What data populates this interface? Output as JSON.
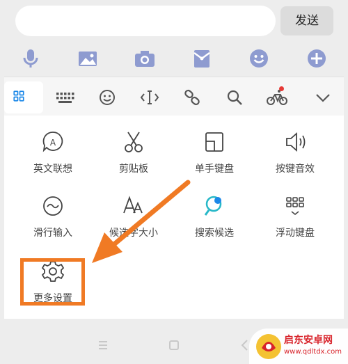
{
  "input": {
    "placeholder": "",
    "value": ""
  },
  "send_label": "发送",
  "toolbar_icons": [
    "microphone-icon",
    "image-icon",
    "camera-icon",
    "red-envelope-icon",
    "emoji-icon",
    "plus-icon"
  ],
  "keyboard_tabs": [
    "grid-icon",
    "keyboard-icon",
    "emoji-icon",
    "cursor-icon",
    "link-icon",
    "search-icon",
    "bike-icon",
    "collapse-icon"
  ],
  "panel": {
    "items": [
      {
        "label": "英文联想",
        "icon": "english-associate-icon"
      },
      {
        "label": "剪贴板",
        "icon": "scissors-icon"
      },
      {
        "label": "单手键盘",
        "icon": "one-hand-keyboard-icon"
      },
      {
        "label": "按键音效",
        "icon": "speaker-icon"
      },
      {
        "label": "滑行输入",
        "icon": "swipe-input-icon"
      },
      {
        "label": "候选字大小",
        "icon": "font-size-icon"
      },
      {
        "label": "搜索候选",
        "icon": "search-candidate-icon"
      },
      {
        "label": "浮动键盘",
        "icon": "floating-keyboard-icon"
      },
      {
        "label": "更多设置",
        "icon": "gear-icon"
      }
    ]
  },
  "watermark": {
    "title": "启东安卓网",
    "url": "www.qdltdx.com"
  },
  "colors": {
    "accent": "#1b88e8",
    "highlight": "#f07a24",
    "badge": "#e63a36",
    "icon": "#9aa6d6"
  }
}
